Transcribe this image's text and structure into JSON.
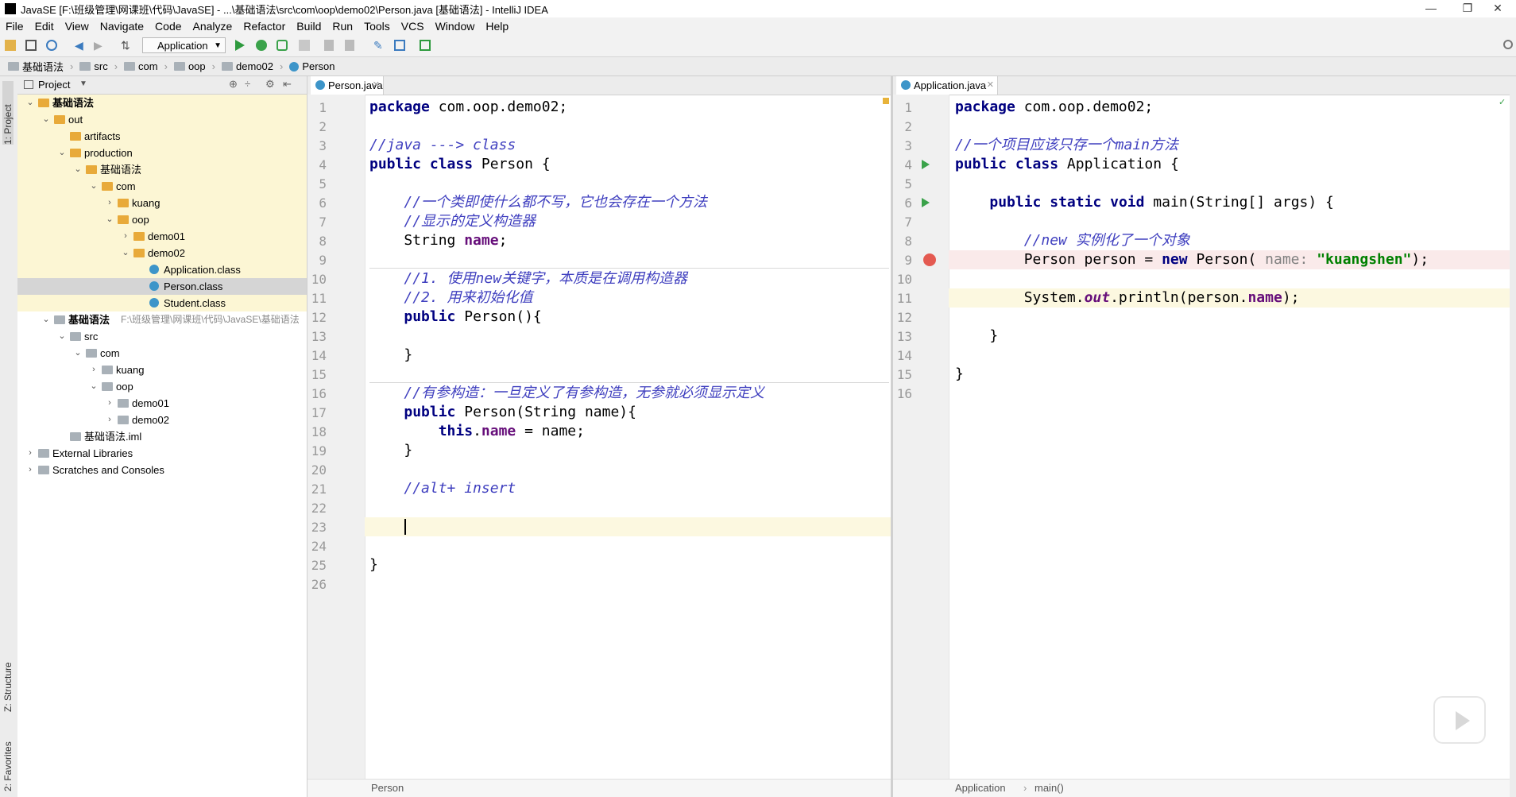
{
  "title_bar": {
    "title": "JavaSE [F:\\班级管理\\网课班\\代码\\JavaSE] - ...\\基础语法\\src\\com\\oop\\demo02\\Person.java [基础语法] - IntelliJ IDEA",
    "minimize": "—",
    "restore": "❐",
    "close": "✕"
  },
  "menu": [
    "File",
    "Edit",
    "View",
    "Navigate",
    "Code",
    "Analyze",
    "Refactor",
    "Build",
    "Run",
    "Tools",
    "VCS",
    "Window",
    "Help"
  ],
  "toolbar": {
    "run_config": "Application"
  },
  "breadcrumbs": [
    "基础语法",
    "src",
    "com",
    "oop",
    "demo02",
    "Person"
  ],
  "side_tabs": {
    "project": "1: Project",
    "structure": "Z: Structure",
    "favorites": "2: Favorites"
  },
  "project_panel": {
    "title": "Project",
    "tree": [
      {
        "label": "基础语法",
        "depth": 0,
        "expanded": true,
        "icon": "module-icon"
      },
      {
        "label": "out",
        "depth": 1,
        "expanded": true,
        "icon": "folder-icon"
      },
      {
        "label": "artifacts",
        "depth": 2,
        "icon": "folder-icon"
      },
      {
        "label": "production",
        "depth": 2,
        "expanded": true,
        "icon": "folder-icon"
      },
      {
        "label": "基础语法",
        "depth": 3,
        "expanded": true,
        "icon": "folder-icon"
      },
      {
        "label": "com",
        "depth": 4,
        "expanded": true,
        "icon": "folder-icon"
      },
      {
        "label": "kuang",
        "depth": 5,
        "expanded": false,
        "icon": "folder-icon"
      },
      {
        "label": "oop",
        "depth": 5,
        "expanded": true,
        "icon": "folder-icon"
      },
      {
        "label": "demo01",
        "depth": 6,
        "expanded": false,
        "icon": "folder-icon"
      },
      {
        "label": "demo02",
        "depth": 6,
        "expanded": true,
        "icon": "folder-icon"
      },
      {
        "label": "Application.class",
        "depth": 7,
        "icon": "class-file-icon"
      },
      {
        "label": "Person.class",
        "depth": 7,
        "icon": "class-file-icon",
        "selected": true
      },
      {
        "label": "Student.class",
        "depth": 7,
        "icon": "class-file-icon"
      },
      {
        "label": "基础语法",
        "path": "F:\\班级管理\\网课班\\代码\\JavaSE\\基础语法",
        "depth": 1,
        "expanded": true,
        "icon": "module-icon"
      },
      {
        "label": "src",
        "depth": 2,
        "expanded": true,
        "icon": "source-folder-icon"
      },
      {
        "label": "com",
        "depth": 3,
        "expanded": true,
        "icon": "package-icon"
      },
      {
        "label": "kuang",
        "depth": 4,
        "expanded": false,
        "icon": "package-icon"
      },
      {
        "label": "oop",
        "depth": 4,
        "expanded": true,
        "icon": "package-icon"
      },
      {
        "label": "demo01",
        "depth": 5,
        "expanded": false,
        "icon": "package-icon"
      },
      {
        "label": "demo02",
        "depth": 5,
        "expanded": false,
        "icon": "package-icon"
      },
      {
        "label": "基础语法.iml",
        "depth": 2,
        "icon": "iml-file-icon"
      },
      {
        "label": "External Libraries",
        "depth": 0,
        "expanded": false,
        "icon": "library-icon"
      },
      {
        "label": "Scratches and Consoles",
        "depth": 0,
        "expanded": false,
        "icon": "scratches-icon"
      }
    ]
  },
  "left_editor": {
    "tab": "Person.java",
    "current_line": 23,
    "status": "Person",
    "lines": [
      "package com.oop.demo02;",
      "",
      "//java ---> class",
      "public class Person {",
      "",
      "    //一个类即使什么都不写，它也会存在一个方法",
      "    //显示的定义构造器",
      "    String name;",
      "",
      "    //1. 使用new关键字，本质是在调用构造器",
      "    //2. 用来初始化值",
      "    public Person(){",
      "",
      "    }",
      "",
      "    //有参构造：一旦定义了有参构造，无参就必须显示定义",
      "    public Person(String name){",
      "        this.name = name;",
      "    }",
      "",
      "    //alt+ insert",
      "",
      "    ",
      "",
      "}",
      ""
    ]
  },
  "right_editor": {
    "tab": "Application.java",
    "current_line": 11,
    "breakpoint_line": 9,
    "status_class": "Application",
    "status_method": "main()",
    "lines": [
      "package com.oop.demo02;",
      "",
      "//一个项目应该只存一个main方法",
      "public class Application {",
      "",
      "    public static void main(String[] args) {",
      "",
      "        //new 实例化了一个对象",
      "        Person person = new Person( name: \"kuangshen\");",
      "",
      "        System.out.println(person.name);",
      "",
      "    }",
      "",
      "}",
      ""
    ]
  }
}
